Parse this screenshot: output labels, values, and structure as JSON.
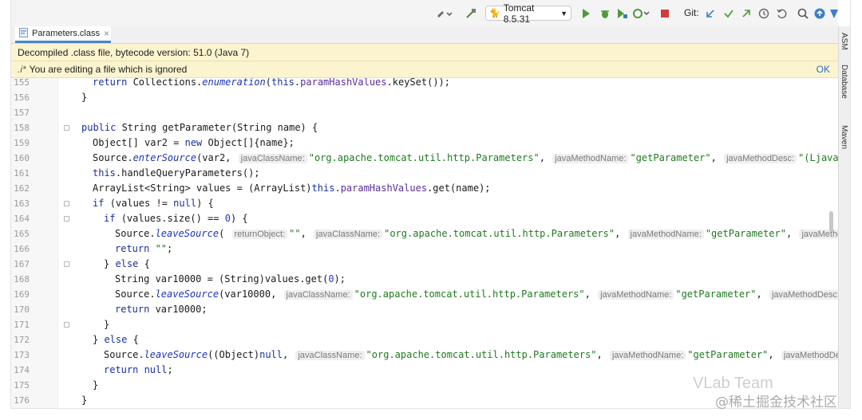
{
  "toolbar": {
    "run_config": "Tomcat 8.5.31",
    "git_label": "Git:"
  },
  "tab": {
    "name": "Parameters.class",
    "close": "×"
  },
  "banner_decompiled": "Decompiled .class file, bytecode version: 51.0 (Java 7)",
  "banner_ignored": {
    "text": "You are editing a file which is ignored",
    "glyph": ".i*",
    "ok": "OK"
  },
  "right_tools": [
    "ASM",
    "Database",
    "Maven"
  ],
  "watermark": {
    "line1": "VLab Team",
    "line2": "@稀土掘金技术社区"
  },
  "code": {
    "lines": [
      {
        "no": "155",
        "indent": 1,
        "parts": [
          [
            "k",
            "return "
          ],
          [
            "t",
            "Collections."
          ],
          [
            "m",
            "enumeration"
          ],
          [
            "t",
            "("
          ],
          [
            "k",
            "this"
          ],
          [
            "t",
            "."
          ],
          [
            "f",
            "paramHashValues"
          ],
          [
            "t",
            ".keySet());"
          ]
        ]
      },
      {
        "no": "156",
        "indent": 0,
        "parts": [
          [
            "t",
            "}"
          ]
        ]
      },
      {
        "no": "157",
        "indent": 0,
        "parts": []
      },
      {
        "no": "158",
        "indent": 0,
        "parts": [
          [
            "k",
            "public "
          ],
          [
            "t",
            "String "
          ],
          [
            "t",
            "getParameter"
          ],
          [
            "t",
            "(String name) {"
          ]
        ]
      },
      {
        "no": "159",
        "indent": 1,
        "parts": [
          [
            "t",
            "Object[] var2 = "
          ],
          [
            "k",
            "new "
          ],
          [
            "t",
            "Object[]{name};"
          ]
        ]
      },
      {
        "no": "160",
        "indent": 1,
        "parts": [
          [
            "t",
            "Source."
          ],
          [
            "m",
            "enterSource"
          ],
          [
            "t",
            "(var2, "
          ],
          [
            "h",
            "javaClassName:"
          ],
          [
            "s",
            "\"org.apache.tomcat.util.http.Parameters\""
          ],
          [
            "t",
            ", "
          ],
          [
            "h",
            "javaMethodName:"
          ],
          [
            "s",
            "\"getParameter\""
          ],
          [
            "t",
            ", "
          ],
          [
            "h",
            "javaMethodDesc:"
          ],
          [
            "s",
            "\"(Ljava/la"
          ]
        ]
      },
      {
        "no": "161",
        "indent": 1,
        "parts": [
          [
            "k",
            "this"
          ],
          [
            "t",
            ".handleQueryParameters();"
          ]
        ]
      },
      {
        "no": "162",
        "indent": 1,
        "parts": [
          [
            "t",
            "ArrayList<String> values = (ArrayList)"
          ],
          [
            "k",
            "this"
          ],
          [
            "t",
            "."
          ],
          [
            "f",
            "paramHashValues"
          ],
          [
            "t",
            ".get(name);"
          ]
        ]
      },
      {
        "no": "163",
        "indent": 1,
        "parts": [
          [
            "k",
            "if "
          ],
          [
            "t",
            "(values != "
          ],
          [
            "k",
            "null"
          ],
          [
            "t",
            ") {"
          ]
        ]
      },
      {
        "no": "164",
        "indent": 2,
        "parts": [
          [
            "k",
            "if "
          ],
          [
            "t",
            "(values.size() == "
          ],
          [
            "n",
            "0"
          ],
          [
            "t",
            ") {"
          ]
        ]
      },
      {
        "no": "165",
        "indent": 3,
        "parts": [
          [
            "t",
            "Source."
          ],
          [
            "m",
            "leaveSource"
          ],
          [
            "t",
            "( "
          ],
          [
            "h",
            "returnObject:"
          ],
          [
            "s",
            "\"\""
          ],
          [
            "t",
            ", "
          ],
          [
            "h",
            "javaClassName:"
          ],
          [
            "s",
            "\"org.apache.tomcat.util.http.Parameters\""
          ],
          [
            "t",
            ", "
          ],
          [
            "h",
            "javaMethodName:"
          ],
          [
            "s",
            "\"getParameter\""
          ],
          [
            "t",
            ", "
          ],
          [
            "h",
            "javaMethodDe"
          ]
        ]
      },
      {
        "no": "166",
        "indent": 3,
        "parts": [
          [
            "k",
            "return "
          ],
          [
            "s",
            "\"\""
          ],
          [
            "t",
            ";"
          ]
        ]
      },
      {
        "no": "167",
        "indent": 2,
        "parts": [
          [
            "t",
            "} "
          ],
          [
            "k",
            "else "
          ],
          [
            "t",
            "{"
          ]
        ]
      },
      {
        "no": "168",
        "indent": 3,
        "parts": [
          [
            "t",
            "String var10000 = (String)values.get("
          ],
          [
            "n",
            "0"
          ],
          [
            "t",
            ");"
          ]
        ]
      },
      {
        "no": "169",
        "indent": 3,
        "parts": [
          [
            "t",
            "Source."
          ],
          [
            "m",
            "leaveSource"
          ],
          [
            "t",
            "(var10000, "
          ],
          [
            "h",
            "javaClassName:"
          ],
          [
            "s",
            "\"org.apache.tomcat.util.http.Parameters\""
          ],
          [
            "t",
            ", "
          ],
          [
            "h",
            "javaMethodName:"
          ],
          [
            "s",
            "\"getParameter\""
          ],
          [
            "t",
            ", "
          ],
          [
            "h",
            "javaMethodDesc:"
          ],
          [
            "s",
            "\"("
          ]
        ]
      },
      {
        "no": "170",
        "indent": 3,
        "parts": [
          [
            "k",
            "return "
          ],
          [
            "t",
            "var10000;"
          ]
        ]
      },
      {
        "no": "171",
        "indent": 2,
        "parts": [
          [
            "t",
            "}"
          ]
        ]
      },
      {
        "no": "172",
        "indent": 1,
        "parts": [
          [
            "t",
            "} "
          ],
          [
            "k",
            "else "
          ],
          [
            "t",
            "{"
          ]
        ]
      },
      {
        "no": "173",
        "indent": 2,
        "parts": [
          [
            "t",
            "Source."
          ],
          [
            "m",
            "leaveSource"
          ],
          [
            "t",
            "((Object)"
          ],
          [
            "k",
            "null"
          ],
          [
            "t",
            ", "
          ],
          [
            "h",
            "javaClassName:"
          ],
          [
            "s",
            "\"org.apache.tomcat.util.http.Parameters\""
          ],
          [
            "t",
            ", "
          ],
          [
            "h",
            "javaMethodName:"
          ],
          [
            "s",
            "\"getParameter\""
          ],
          [
            "t",
            ", "
          ],
          [
            "h",
            "javaMethodDesc:"
          ]
        ]
      },
      {
        "no": "174",
        "indent": 2,
        "parts": [
          [
            "k",
            "return null"
          ],
          [
            "t",
            ";"
          ]
        ]
      },
      {
        "no": "175",
        "indent": 1,
        "parts": [
          [
            "t",
            "}"
          ]
        ]
      },
      {
        "no": "176",
        "indent": 0,
        "parts": [
          [
            "t",
            "}"
          ]
        ]
      }
    ]
  },
  "colors": {
    "banner_bg": "#fbf4cf",
    "keyword": "#1a2fa0",
    "string": "#1f7a1f",
    "tab_accent": "#4a86c8"
  }
}
